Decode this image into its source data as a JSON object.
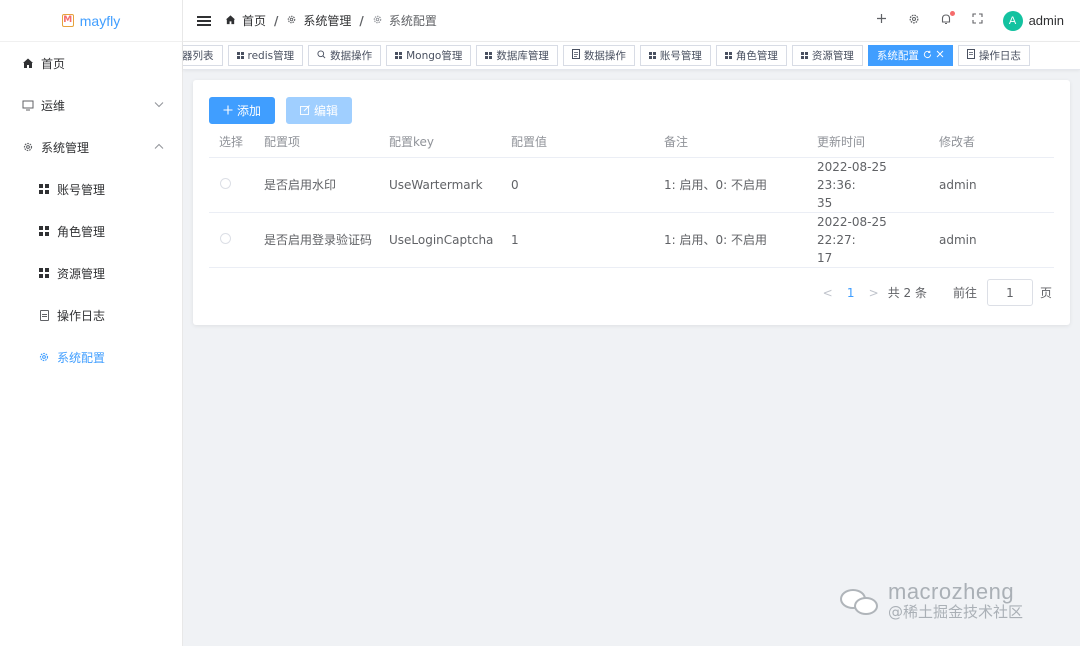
{
  "app": {
    "title": "mayfly",
    "logo_letter": "M"
  },
  "sidebar": {
    "items": [
      {
        "label": "首页",
        "icon": "home-icon"
      },
      {
        "label": "运维",
        "icon": "monitor-icon",
        "arrow": "chevron-down"
      },
      {
        "label": "系统管理",
        "icon": "gear-icon",
        "arrow": "chevron-up"
      },
      {
        "label": "账号管理",
        "icon": "grid-icon"
      },
      {
        "label": "角色管理",
        "icon": "grid-icon"
      },
      {
        "label": "资源管理",
        "icon": "grid-icon"
      },
      {
        "label": "操作日志",
        "icon": "document-icon"
      },
      {
        "label": "系统配置",
        "icon": "gear-icon",
        "active": true
      }
    ]
  },
  "header": {
    "breadcrumb": [
      "首页",
      "系统管理",
      "系统配置"
    ],
    "user": {
      "avatar_letter": "A",
      "name": "admin"
    }
  },
  "tabs": [
    {
      "label": "器列表"
    },
    {
      "label": "redis管理"
    },
    {
      "label": "数据操作"
    },
    {
      "label": "Mongo管理"
    },
    {
      "label": "数据库管理"
    },
    {
      "label": "数据操作"
    },
    {
      "label": "账号管理"
    },
    {
      "label": "角色管理"
    },
    {
      "label": "资源管理"
    },
    {
      "label": "系统配置",
      "active": true
    },
    {
      "label": "操作日志"
    }
  ],
  "toolbar": {
    "add_label": "添加",
    "edit_label": "编辑"
  },
  "table": {
    "headers": [
      "选择",
      "配置项",
      "配置key",
      "配置值",
      "备注",
      "更新时间",
      "修改者"
    ],
    "rows": [
      {
        "name": "是否启用水印",
        "key": "UseWartermark",
        "value": "0",
        "remark": "1: 启用、0: 不启用",
        "updated_1": "2022-08-25 23:36:",
        "updated_2": "35",
        "modifier": "admin"
      },
      {
        "name": "是否启用登录验证码",
        "key": "UseLoginCaptcha",
        "value": "1",
        "remark": "1: 启用、0: 不启用",
        "updated_1": "2022-08-25 22:27:",
        "updated_2": "17",
        "modifier": "admin"
      }
    ]
  },
  "pagination": {
    "prev": "<",
    "current": "1",
    "next": ">",
    "total": "共 2 条",
    "goto": "前往",
    "page_value": "1",
    "page_unit": "页"
  },
  "watermark": {
    "line1": "macrozheng",
    "line2": "@稀土掘金技术社区"
  },
  "colors": {
    "primary": "#409eff",
    "avatar": "#13c2a0",
    "badge": "#f56c6c"
  }
}
